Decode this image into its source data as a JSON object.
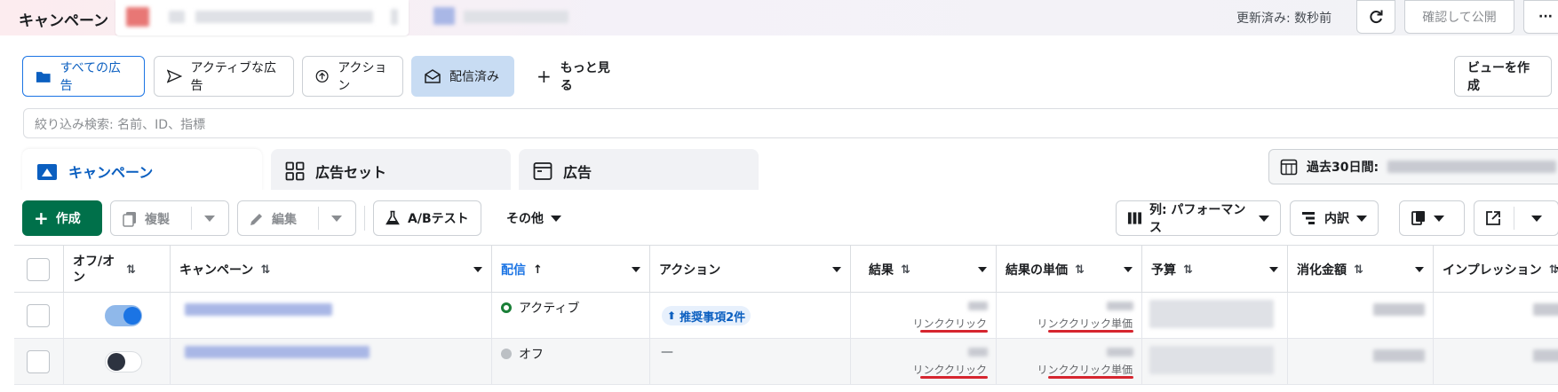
{
  "header": {
    "title": "キャンペーン",
    "updated": "更新済み: 数秒前",
    "publish_label": "確認して公開",
    "more_label": "···"
  },
  "filters": {
    "all_ads": "すべての広告",
    "active_ads": "アクティブな広告",
    "actions": "アクション",
    "delivered": "配信済み",
    "see_more": "もっと見る",
    "create_view": "ビューを作成"
  },
  "search": {
    "placeholder": "絞り込み検索: 名前、ID、指標"
  },
  "level_tabs": {
    "campaign": "キャンペーン",
    "adset": "広告セット",
    "ad": "広告"
  },
  "date_range": {
    "label": "過去30日間:"
  },
  "toolbar": {
    "create": "作成",
    "duplicate": "複製",
    "edit": "編集",
    "ab_test": "A/Bテスト",
    "other": "その他",
    "columns": "列: パフォーマンス",
    "breakdown": "内訳"
  },
  "table": {
    "headers": {
      "toggle": "オフ/オン",
      "campaign": "キャンペーン",
      "delivery": "配信",
      "action": "アクション",
      "result": "結果",
      "cost_per_result": "結果の単価",
      "budget": "予算",
      "spend": "消化金額",
      "impressions": "インプレッション"
    },
    "rows": [
      {
        "toggle": "on",
        "delivery": "アクティブ",
        "action": "推奨事項2件",
        "result_label": "リンククリック",
        "cost_label": "リンククリック単価"
      },
      {
        "toggle": "off",
        "delivery": "オフ",
        "action": "—",
        "result_label": "リンククリック",
        "cost_label": "リンククリック単価"
      }
    ]
  },
  "colors": {
    "accent": "#1b74e4",
    "create_green": "#00704a",
    "active_green": "#1a7f37",
    "off_grey": "#bcc0c4",
    "annotation_red": "#d6252f"
  }
}
